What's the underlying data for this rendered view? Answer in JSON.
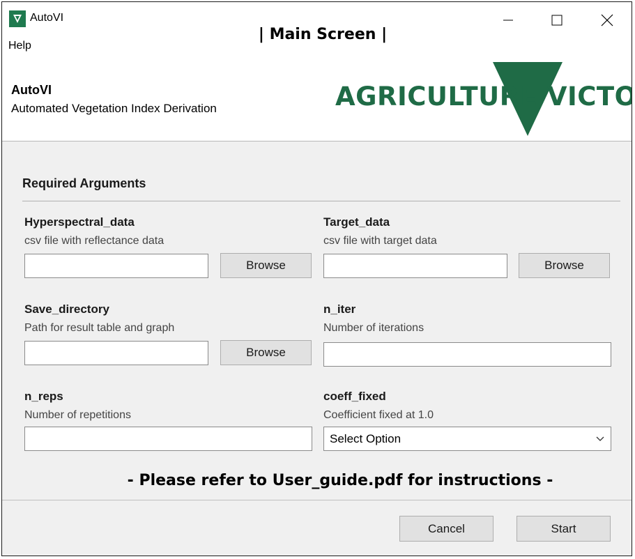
{
  "window": {
    "title": "AutoVI",
    "icon": "agriculture-victoria-icon",
    "controls": {
      "minimize": "minimize-icon",
      "maximize": "maximize-icon",
      "close": "close-icon"
    }
  },
  "menu": {
    "help": "Help"
  },
  "screen_title": "| Main Screen |",
  "header": {
    "title": "AutoVI",
    "subtitle": "Automated Vegetation Index Derivation",
    "logo_text": "AGRICULTURE VICTORIA",
    "brand_color": "#1f6b46"
  },
  "section": {
    "title": "Required Arguments"
  },
  "fields": {
    "hyperspectral": {
      "label": "Hyperspectral_data",
      "desc": "csv file with reflectance data",
      "value": "",
      "browse": "Browse"
    },
    "target": {
      "label": "Target_data",
      "desc": "csv file with target data",
      "value": "",
      "browse": "Browse"
    },
    "save_dir": {
      "label": "Save_directory",
      "desc": "Path for result table and graph",
      "value": "",
      "browse": "Browse"
    },
    "n_iter": {
      "label": "n_iter",
      "desc": "Number of iterations",
      "value": ""
    },
    "n_reps": {
      "label": "n_reps",
      "desc": "Number of repetitions",
      "value": ""
    },
    "coeff_fixed": {
      "label": "coeff_fixed",
      "desc": "Coefficient fixed at 1.0",
      "selected": "Select Option"
    }
  },
  "note": "- Please refer to User_guide.pdf for instructions -",
  "footer": {
    "cancel": "Cancel",
    "start": "Start"
  }
}
